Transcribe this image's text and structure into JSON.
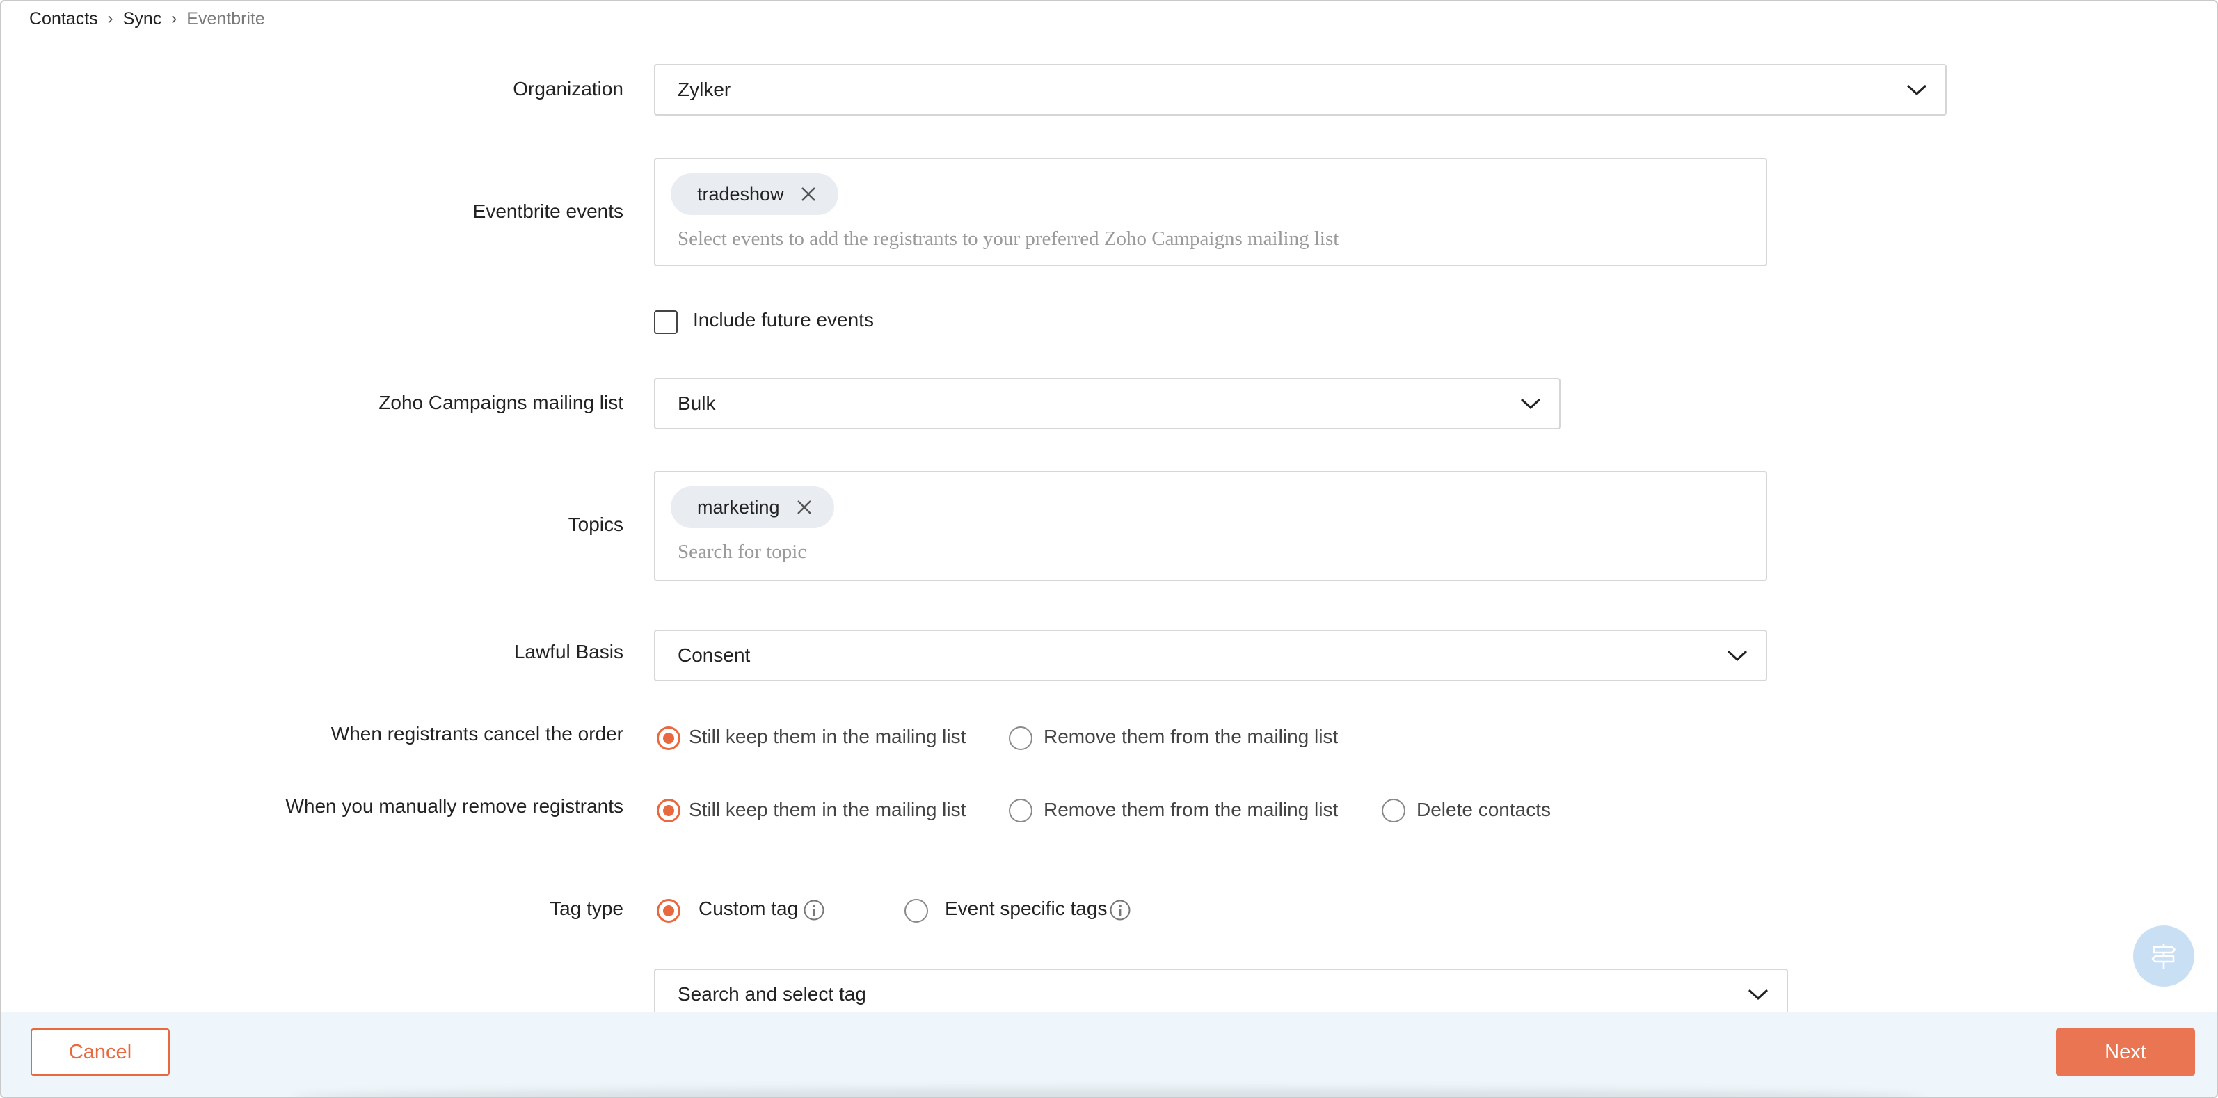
{
  "breadcrumb": {
    "items": [
      "Contacts",
      "Sync"
    ],
    "current": "Eventbrite"
  },
  "form": {
    "organization": {
      "label": "Organization",
      "value": "Zylker"
    },
    "events": {
      "label": "Eventbrite events",
      "chip": "tradeshow",
      "placeholder": "Select events to add the registrants to your preferred Zoho Campaigns mailing list",
      "include_future_label": "Include future events"
    },
    "mailing_list": {
      "label": "Zoho Campaigns mailing list",
      "value": "Bulk"
    },
    "topics": {
      "label": "Topics",
      "chip": "marketing",
      "placeholder": "Search for topic"
    },
    "lawful_basis": {
      "label": "Lawful Basis",
      "value": "Consent"
    },
    "cancel_order": {
      "label": "When registrants cancel the order",
      "options": [
        "Still keep them in the mailing list",
        "Remove them from the mailing list"
      ],
      "selected": 0
    },
    "manual_remove": {
      "label": "When you manually remove registrants",
      "options": [
        "Still keep them in the mailing list",
        "Remove them from the mailing list",
        "Delete contacts"
      ],
      "selected": 0
    },
    "tag_type": {
      "label": "Tag type",
      "options": [
        "Custom tag",
        "Event specific tags"
      ],
      "selected": 0
    },
    "tag_select": {
      "value": "Search and select tag"
    }
  },
  "footer": {
    "cancel_label": "Cancel",
    "next_label": "Next"
  },
  "colors": {
    "accent": "#e8683f",
    "footer_bg": "#eef6fb",
    "fab_bg": "#c9dff4"
  },
  "icons": {
    "chevron": "chevron-down-icon",
    "chip_remove": "close-icon",
    "info": "info-icon",
    "fab": "signpost-icon"
  }
}
